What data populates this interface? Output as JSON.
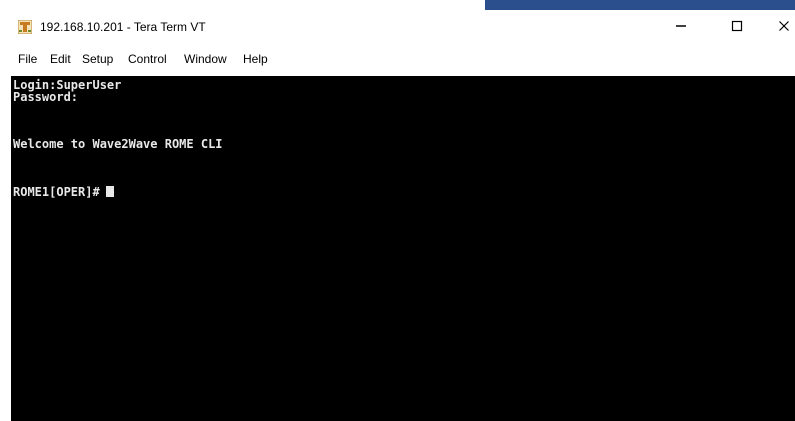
{
  "window": {
    "title": "192.168.10.201 - Tera Term VT",
    "icon": "tera-term-app-icon",
    "controls": {
      "minimize": "—",
      "maximize": "☐",
      "close": "✕"
    }
  },
  "menu": {
    "file": "File",
    "edit": "Edit",
    "setup": "Setup",
    "control": "Control",
    "window": "Window",
    "help": "Help"
  },
  "terminal": {
    "lines": [
      "Login:SuperUser",
      "Password:",
      "Welcome to Wave2Wave ROME CLI",
      "ROME1[OPER]#"
    ],
    "background": "#000000",
    "foreground": "#e8e8e8"
  },
  "colors": {
    "titlebar_accent": "#2b4f8c"
  }
}
